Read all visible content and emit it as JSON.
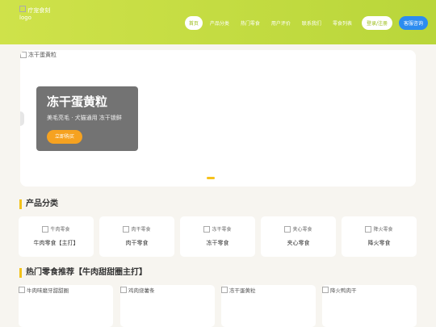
{
  "header": {
    "logo_alt": "疗宠食刻",
    "logo_alt2": "logo",
    "nav": [
      "首页",
      "产品分类",
      "热门零食",
      "用户评价",
      "联系我们",
      "零食列表"
    ],
    "login_label": "登录/注册",
    "service_label": "客服咨询"
  },
  "banner": {
    "image_alt": "冻干蛋黄粒",
    "title": "冻干蛋黄粒",
    "subtitle": "美毛亮毛 · 犬猫通用 冻干锁鲜",
    "button": "立即购买"
  },
  "categories": {
    "title": "产品分类",
    "items": [
      {
        "alt": "牛肉零食",
        "label": "牛肉零食【主打】"
      },
      {
        "alt": "肉干零食",
        "label": "肉干零食"
      },
      {
        "alt": "冻干零食",
        "label": "冻干零食"
      },
      {
        "alt": "夹心零食",
        "label": "夹心零食"
      },
      {
        "alt": "降火零食",
        "label": "降火零食"
      }
    ]
  },
  "hot": {
    "title": "热门零食推荐【牛肉甜甜圈主打】",
    "items": [
      {
        "alt": "牛肉味磨牙甜甜圈"
      },
      {
        "alt": "鸡肉烧薯条"
      },
      {
        "alt": "冻干蛋黄粒"
      },
      {
        "alt": "降火鸭肉干"
      }
    ]
  },
  "colors": {
    "accent": "#b9d63a",
    "orange": "#f6a220",
    "blue": "#2c8cf0",
    "yellow": "#f2c21a"
  }
}
